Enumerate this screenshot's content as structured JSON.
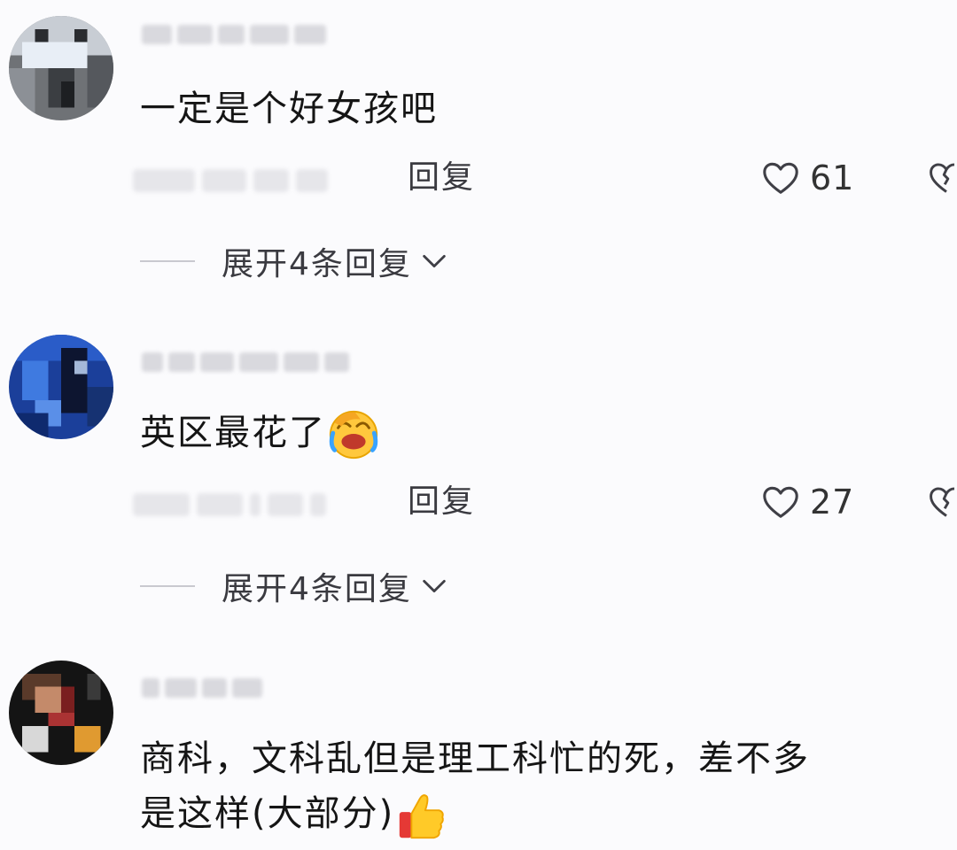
{
  "comments": [
    {
      "text": "一定是个好女孩吧",
      "reply_label": "回复",
      "like_count": "61",
      "expand_label": "展开4条回复"
    },
    {
      "text": "英区最花了",
      "emoji": "face-with-tears-emoji",
      "reply_label": "回复",
      "like_count": "27",
      "expand_label": "展开4条回复"
    },
    {
      "text_line1": "商科，文科乱但是理工科忙的死，差不多",
      "text_line2": "是这样(大部分)",
      "emoji": "thumbs-up-emoji"
    }
  ],
  "colors": {
    "background": "#fbfbfd",
    "text": "#151515",
    "secondary_text": "#3a3a40",
    "icon_stroke": "#3f3f46"
  }
}
